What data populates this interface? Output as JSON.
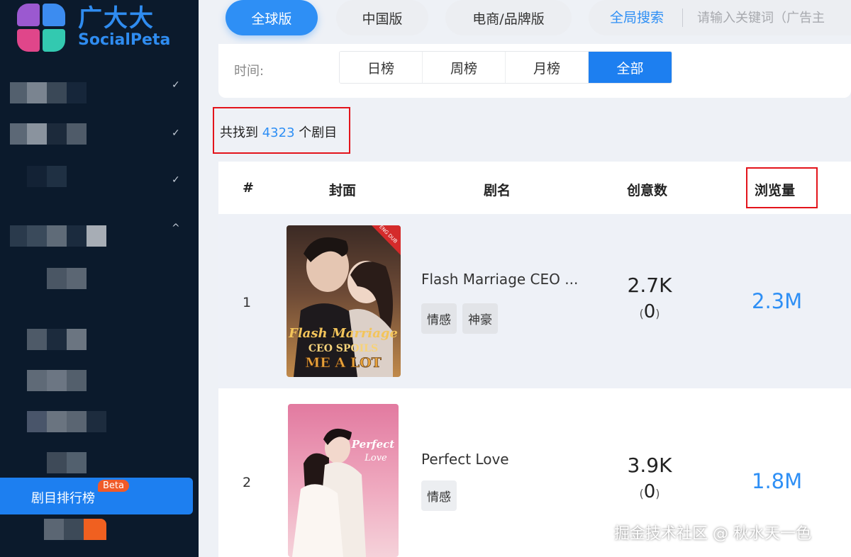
{
  "brand": {
    "name_cn": "广大大",
    "name_en": "SocialPeta"
  },
  "colors": {
    "accent": "#1d7ff0",
    "sidebar_bg": "#0b1a2c",
    "highlight_box": "#e3141b",
    "beta": "#f05a28"
  },
  "sidebar": {
    "active_item": {
      "label": "剧目排行榜",
      "badge": "Beta"
    },
    "chevrons": [
      "✓",
      "✓",
      "✓",
      "^"
    ]
  },
  "top_tabs": [
    {
      "label": "全球版",
      "active": true
    },
    {
      "label": "中国版",
      "active": false
    },
    {
      "label": "电商/品牌版",
      "active": false
    }
  ],
  "search": {
    "scope": "全局搜索",
    "placeholder": "请输入关键词（广告主"
  },
  "filter": {
    "label": "时间:",
    "options": [
      "日榜",
      "周榜",
      "月榜",
      "全部"
    ],
    "selected": "全部"
  },
  "result": {
    "prefix": "共找到",
    "count": "4323",
    "suffix": "个剧目"
  },
  "table": {
    "headers": {
      "rank": "#",
      "cover": "封面",
      "title": "剧名",
      "creatives": "创意数",
      "views": "浏览量"
    },
    "rows": [
      {
        "rank": "1",
        "cover": {
          "icon": "drama-cover-flash-marriage",
          "overlay_text": [
            "Flash Marriage",
            "CEO SPOILS",
            "ME A LOT"
          ],
          "corner": "ENG DUB"
        },
        "title": "Flash Marriage CEO ...",
        "tags": [
          "情感",
          "神豪"
        ],
        "creatives": "2.7K",
        "creatives_paren": "0",
        "views": "2.3M"
      },
      {
        "rank": "2",
        "cover": {
          "icon": "drama-cover-perfect-love",
          "overlay_text": [
            "Perfect",
            "Love"
          ]
        },
        "title": "Perfect Love",
        "tags": [
          "情感"
        ],
        "creatives": "3.9K",
        "creatives_paren": "0",
        "views": "1.8M"
      }
    ]
  },
  "watermark": "掘金技术社区 @ 秋水天一色"
}
